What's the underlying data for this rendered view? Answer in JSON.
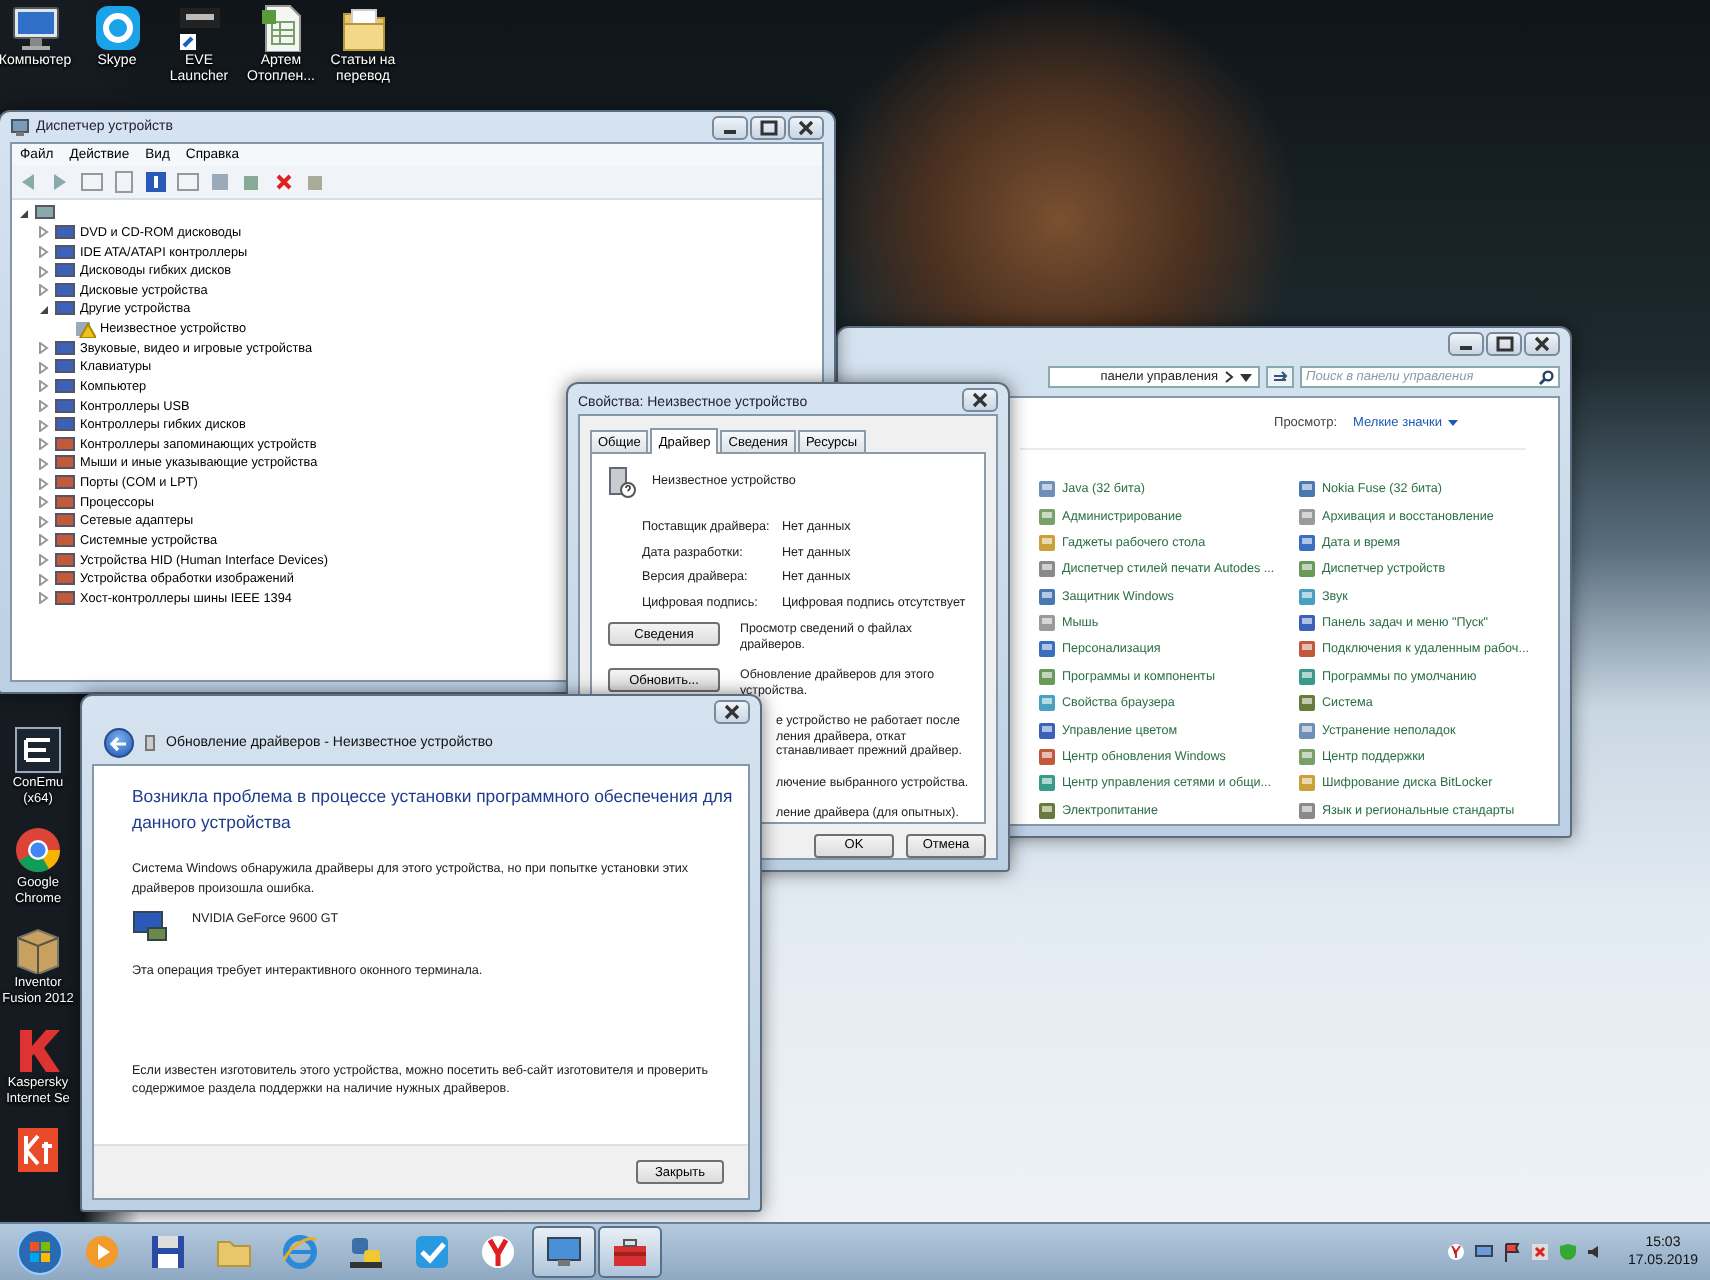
{
  "desktop_icons": [
    {
      "kind": "computer",
      "label": "Компьютер"
    },
    {
      "kind": "skype",
      "label": "Skype"
    },
    {
      "kind": "eve",
      "label": "EVE Launcher"
    },
    {
      "kind": "spreadsheet",
      "label": "Артем Отоплен..."
    },
    {
      "kind": "folder",
      "label": "Статьи на перевод"
    }
  ],
  "side_icons": [
    {
      "kind": "terminal",
      "label": "ConEmu (x64)"
    },
    {
      "kind": "chrome",
      "label": "Google Chrome"
    },
    {
      "kind": "inventor",
      "label": "Inventor Fusion 2012"
    },
    {
      "kind": "kaspersky",
      "label": "Kaspersky Internet Se"
    },
    {
      "kind": "kt"
    }
  ],
  "device_manager": {
    "title": "Диспетчер устройств",
    "menu": [
      "Файл",
      "Действие",
      "Вид",
      "Справка"
    ],
    "tree": {
      "expanded": true,
      "children": [
        {
          "label": "DVD и CD-ROM дисководы",
          "expanded": false
        },
        {
          "label": "IDE ATA/ATAPI контроллеры",
          "expanded": false
        },
        {
          "label": "Дисководы гибких дисков",
          "expanded": false
        },
        {
          "label": "Дисковые устройства",
          "expanded": false
        },
        {
          "label": "Другие устройства",
          "expanded": true,
          "children": [
            {
              "label": "Неизвестное устройство",
              "warning": true
            }
          ]
        },
        {
          "label": "Звуковые, видео и игровые устройства",
          "expanded": false
        },
        {
          "label": "Клавиатуры",
          "expanded": false
        },
        {
          "label": "Компьютер",
          "expanded": false
        },
        {
          "label": "Контроллеры USB",
          "expanded": false
        },
        {
          "label": "Контроллеры гибких дисков",
          "expanded": false
        },
        {
          "label": "Контроллеры запоминающих устройств",
          "expanded": false
        },
        {
          "label": "Мыши и иные указывающие устройства",
          "expanded": false
        },
        {
          "label": "Порты (COM и LPT)",
          "expanded": false
        },
        {
          "label": "Процессоры",
          "expanded": false
        },
        {
          "label": "Сетевые адаптеры",
          "expanded": false
        },
        {
          "label": "Системные устройства",
          "expanded": false
        },
        {
          "label": "Устройства HID (Human Interface Devices)",
          "expanded": false
        },
        {
          "label": "Устройства обработки изображений",
          "expanded": false
        },
        {
          "label": "Хост-контроллеры шины IEEE 1394",
          "expanded": false
        }
      ]
    }
  },
  "control_panel": {
    "address": "панели управления",
    "search": {
      "placeholder": "Поиск в панели управления"
    },
    "view_label": "Просмотр:",
    "view_value": "Мелкие значки",
    "columns": [
      [
        "Java (32 бита)",
        "Администрирование",
        "Гаджеты рабочего стола",
        "Диспетчер стилей печати Autodes ...",
        "Защитник Windows",
        "Мышь",
        "Персонализация",
        "Программы и компоненты",
        "Свойства браузера",
        "Управление цветом",
        "Центр обновления Windows",
        "Центр управления сетями и общи...",
        "Электропитание"
      ],
      [
        "Nokia Fuse (32 бита)",
        "Архивация и восстановление",
        "Дата и время",
        "Диспетчер устройств",
        "Звук",
        "Панель задач и меню \"Пуск\"",
        "Подключения к удаленным рабоч...",
        "Программы по умолчанию",
        "Система",
        "Устранение неполадок",
        "Центр поддержки",
        "Шифрование диска BitLocker",
        "Язык и региональные стандарты"
      ]
    ]
  },
  "properties": {
    "title": "Свойства: Неизвестное устройство",
    "tabs": [
      {
        "label": "Общие",
        "selected": false
      },
      {
        "label": "Драйвер",
        "selected": true
      },
      {
        "label": "Сведения",
        "selected": false
      },
      {
        "label": "Ресурсы",
        "selected": false
      }
    ],
    "device": "Неизвестное устройство",
    "fields": [
      {
        "label": "Поставщик драйвера:",
        "value": "Нет данных"
      },
      {
        "label": "Дата разработки:",
        "value": "Нет данных"
      },
      {
        "label": "Версия драйвера:",
        "value": "Нет данных"
      },
      {
        "label": "Цифровая подпись:",
        "value": "Цифровая подпись отсутствует"
      }
    ],
    "actions": [
      {
        "kind": "button",
        "button": "Сведения",
        "text": "Просмотр сведений о файлах драйверов."
      },
      {
        "kind": "button",
        "button": "Обновить...",
        "text": "Обновление драйверов для этого устройства."
      },
      {
        "kind": "covered",
        "lines": [
          "е устройство не работает после",
          "ления драйвера, откат",
          "станавливает прежний драйвер."
        ]
      },
      {
        "kind": "covered",
        "lines": [
          "лючение выбранного устройства."
        ]
      },
      {
        "kind": "covered",
        "lines": [
          "ление драйвера (для опытных)."
        ]
      }
    ],
    "buttons": [
      "OK",
      "Отмена"
    ]
  },
  "driver_update": {
    "title": "Обновление драйверов - Неизвестное устройство",
    "heading": "Возникла проблема в процессе установки программного обеспечения для данного устройства",
    "message": "Система Windows обнаружила драйверы для этого устройства, но при попытке установки этих драйверов произошла ошибка.",
    "device": "NVIDIA GeForce 9600 GT",
    "note": "Эта операция требует интерактивного оконного терминала.",
    "footer_text": "Если известен изготовитель этого устройства, можно посетить веб-сайт изготовителя и проверить содержимое раздела поддержки на наличие нужных драйверов.",
    "button": "Закрыть"
  },
  "taskbar": {
    "buttons": [
      {
        "kind": "player",
        "selected": false
      },
      {
        "kind": "floppy",
        "selected": false
      },
      {
        "kind": "folder",
        "selected": false
      },
      {
        "kind": "ie",
        "selected": false
      },
      {
        "kind": "python",
        "selected": false
      },
      {
        "kind": "check",
        "selected": false
      },
      {
        "kind": "yandex",
        "selected": false
      },
      {
        "kind": "monitor",
        "selected": true
      },
      {
        "kind": "toolbox",
        "selected": true
      }
    ]
  },
  "clock": {
    "time": "15:03",
    "date": "17.05.2019"
  }
}
